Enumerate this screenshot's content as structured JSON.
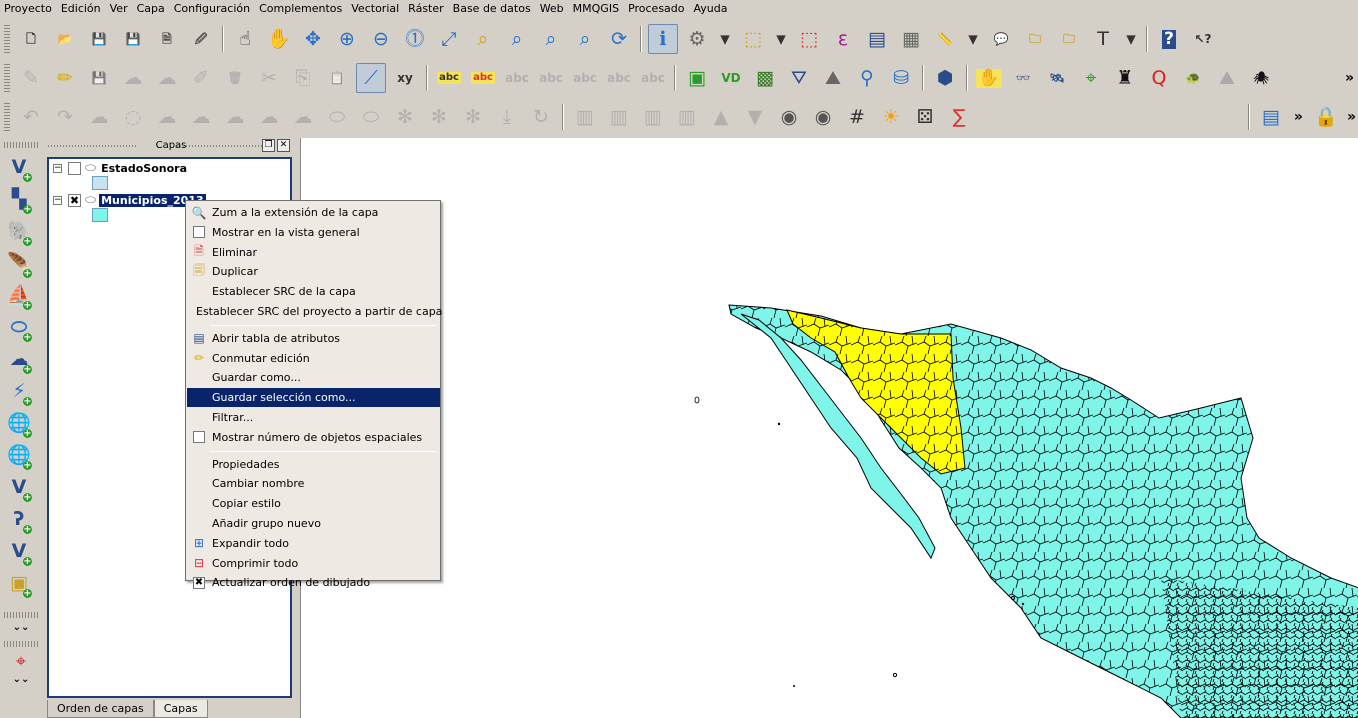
{
  "menubar": [
    "Proyecto",
    "Edición",
    "Ver",
    "Capa",
    "Configuración",
    "Complementos",
    "Vectorial",
    "Ráster",
    "Base de datos",
    "Web",
    "MMQGIS",
    "Procesado",
    "Ayuda"
  ],
  "toolbar1": [
    {
      "name": "new-project-icon",
      "g": "🗋",
      "c": "#333"
    },
    {
      "name": "open-project-icon",
      "g": "📂",
      "c": "#c9a227"
    },
    {
      "name": "save-project-icon",
      "g": "💾",
      "c": "#3c5a8c"
    },
    {
      "name": "save-as-icon",
      "g": "💾",
      "c": "#3c5a8c"
    },
    {
      "name": "new-print-composer-icon",
      "g": "🗎",
      "c": "#555"
    },
    {
      "name": "composer-manager-icon",
      "g": "🖉",
      "c": "#555"
    },
    {
      "sep": true
    },
    {
      "name": "touch-zoom-icon",
      "g": "☝",
      "c": "#333"
    },
    {
      "name": "pan-icon",
      "g": "✋",
      "c": "#333"
    },
    {
      "name": "pan-to-selection-icon",
      "g": "✥",
      "c": "#2a6fc9"
    },
    {
      "name": "zoom-in-icon",
      "g": "⊕",
      "c": "#2a6fc9"
    },
    {
      "name": "zoom-out-icon",
      "g": "⊖",
      "c": "#2a6fc9"
    },
    {
      "name": "zoom-native-icon",
      "g": "⓵",
      "c": "#2a6fc9"
    },
    {
      "name": "zoom-full-icon",
      "g": "⤢",
      "c": "#2a6fc9"
    },
    {
      "name": "zoom-to-selection-icon",
      "g": "⌕",
      "c": "#c9a227"
    },
    {
      "name": "zoom-to-layer-icon",
      "g": "⌕",
      "c": "#2a6fc9"
    },
    {
      "name": "zoom-last-icon",
      "g": "⌕",
      "c": "#2a6fc9"
    },
    {
      "name": "zoom-next-icon",
      "g": "⌕",
      "c": "#2a6fc9"
    },
    {
      "name": "refresh-icon",
      "g": "⟳",
      "c": "#2a6fc9"
    },
    {
      "sep": true
    },
    {
      "name": "identify-icon",
      "g": "ℹ",
      "c": "#2a6fc9",
      "pressed": true
    },
    {
      "name": "run-action-icon",
      "g": "⚙",
      "c": "#666"
    },
    {
      "name": "action-dropdown-icon",
      "g": "▾",
      "c": "#333",
      "sm": true
    },
    {
      "name": "select-features-icon",
      "g": "⬚",
      "c": "#c9a227"
    },
    {
      "name": "select-dropdown-icon",
      "g": "▾",
      "c": "#333",
      "sm": true
    },
    {
      "name": "deselect-icon",
      "g": "⬚",
      "c": "#d33"
    },
    {
      "name": "select-by-expression-icon",
      "g": "ε",
      "c": "#a0208c"
    },
    {
      "name": "attribute-table-icon",
      "g": "▤",
      "c": "#2a4c8c"
    },
    {
      "name": "field-calculator-icon",
      "g": "▦",
      "c": "#666"
    },
    {
      "name": "measure-icon",
      "g": "📏",
      "c": "#333"
    },
    {
      "name": "measure-dropdown-icon",
      "g": "▾",
      "c": "#333",
      "sm": true
    },
    {
      "name": "map-tips-icon",
      "g": "💬",
      "c": "#c9a227"
    },
    {
      "name": "new-bookmark-icon",
      "g": "🗀",
      "c": "#c9a227"
    },
    {
      "name": "show-bookmarks-icon",
      "g": "🗀",
      "c": "#c9a227"
    },
    {
      "name": "text-annotation-icon",
      "g": "T",
      "c": "#333"
    },
    {
      "name": "annotation-dropdown-icon",
      "g": "▾",
      "c": "#333",
      "sm": true
    },
    {
      "sep": true
    },
    {
      "name": "help-contents-icon",
      "g": "?",
      "c": "#fff",
      "bg": "#2a4c8c"
    },
    {
      "name": "whats-this-icon",
      "g": "↖?",
      "c": "#333"
    }
  ],
  "toolbar2": [
    {
      "name": "current-edits-icon",
      "g": "✎",
      "c": "#999",
      "dis": true
    },
    {
      "name": "toggle-editing-icon",
      "g": "✏",
      "c": "#d8a800"
    },
    {
      "name": "save-edits-icon",
      "g": "💾",
      "c": "#999",
      "dis": true
    },
    {
      "name": "add-feature-icon",
      "g": "☁",
      "c": "#999",
      "dis": true
    },
    {
      "name": "move-feature-icon",
      "g": "☁",
      "c": "#999",
      "dis": true
    },
    {
      "name": "node-tool-icon",
      "g": "✐",
      "c": "#999",
      "dis": true
    },
    {
      "name": "delete-selected-icon",
      "g": "🗑",
      "c": "#999",
      "dis": true
    },
    {
      "name": "cut-features-icon",
      "g": "✂",
      "c": "#999",
      "dis": true
    },
    {
      "name": "copy-features-icon",
      "g": "⎘",
      "c": "#999",
      "dis": true
    },
    {
      "name": "paste-features-icon",
      "g": "📋",
      "c": "#999",
      "dis": true
    },
    {
      "name": "measure-line-icon",
      "g": "⟋",
      "c": "#2a6fc9",
      "pressed": true
    },
    {
      "name": "xy-tool-icon",
      "g": "xy",
      "c": "#333"
    },
    {
      "sep": true
    },
    {
      "name": "label-icon",
      "g": "abc",
      "c": "#333",
      "bg": "#f5e35a"
    },
    {
      "name": "layer-labeling-icon",
      "g": "abc",
      "c": "#d33",
      "bg": "#f5e35a"
    },
    {
      "name": "pin-labels-icon",
      "g": "abc",
      "c": "#999",
      "dis": true
    },
    {
      "name": "show-hide-labels-icon",
      "g": "abc",
      "c": "#999",
      "dis": true
    },
    {
      "name": "move-label-icon",
      "g": "abc",
      "c": "#999",
      "dis": true
    },
    {
      "name": "rotate-label-icon",
      "g": "abc",
      "c": "#999",
      "dis": true
    },
    {
      "name": "change-label-icon",
      "g": "abc",
      "c": "#999",
      "dis": true
    },
    {
      "sep": true
    },
    {
      "name": "grass-tools-icon",
      "g": "▣",
      "c": "#2a9c2a"
    },
    {
      "name": "vd-plugin-icon",
      "g": "VD",
      "c": "#2a9c2a"
    },
    {
      "name": "raster-calc-icon",
      "g": "▩",
      "c": "#3a7a2a"
    },
    {
      "name": "interpolation-icon",
      "g": "⛛",
      "c": "#2a4c8c"
    },
    {
      "name": "terrain-icon",
      "g": "⛰",
      "c": "#666"
    },
    {
      "name": "georeferencer-icon",
      "g": "⚲",
      "c": "#2a6fc9"
    },
    {
      "name": "db-manager-icon",
      "g": "⛁",
      "c": "#2a6fc9"
    },
    {
      "sep": true
    },
    {
      "name": "osm-icon",
      "g": "⬢",
      "c": "#2a4c8c"
    },
    {
      "sep": true
    },
    {
      "name": "digitize-icon",
      "g": "✋",
      "c": "#2a6c2a",
      "bg": "#f5e35a"
    },
    {
      "name": "binoculars-icon",
      "g": "👓",
      "c": "#333"
    },
    {
      "name": "satellite-icon",
      "g": "🛰",
      "c": "#2a4c8c"
    },
    {
      "name": "layer-finder-icon",
      "g": "⌖",
      "c": "#2a9c2a"
    },
    {
      "name": "gps-icon",
      "g": "♜",
      "c": "#111"
    },
    {
      "name": "qgis-cloud-icon",
      "g": "Q",
      "c": "#e21c1c"
    },
    {
      "name": "turtle-icon",
      "g": "🐢",
      "c": "#b83030"
    },
    {
      "name": "mountain-icon",
      "g": "⛰",
      "c": "#aaa"
    },
    {
      "name": "spider-icon",
      "g": "🕷",
      "c": "#111"
    }
  ],
  "toolbar3": [
    {
      "name": "undo-icon",
      "g": "↶",
      "c": "#999",
      "dis": true
    },
    {
      "name": "redo-icon",
      "g": "↷",
      "c": "#999",
      "dis": true
    },
    {
      "name": "simplify-icon",
      "g": "☁",
      "c": "#999",
      "dis": true
    },
    {
      "name": "add-ring-icon",
      "g": "◌",
      "c": "#999",
      "dis": true
    },
    {
      "name": "add-part-icon",
      "g": "☁",
      "c": "#999",
      "dis": true
    },
    {
      "name": "fill-ring-icon",
      "g": "☁",
      "c": "#999",
      "dis": true
    },
    {
      "name": "delete-ring-icon",
      "g": "☁",
      "c": "#999",
      "dis": true
    },
    {
      "name": "delete-part-icon",
      "g": "☁",
      "c": "#999",
      "dis": true
    },
    {
      "name": "reshape-icon",
      "g": "☁",
      "c": "#999",
      "dis": true
    },
    {
      "name": "offset-curve-icon",
      "g": "⬭",
      "c": "#999",
      "dis": true
    },
    {
      "name": "split-features-icon",
      "g": "⬭",
      "c": "#999",
      "dis": true
    },
    {
      "name": "split-parts-icon",
      "g": "✻",
      "c": "#999",
      "dis": true
    },
    {
      "name": "merge-features-icon",
      "g": "✻",
      "c": "#999",
      "dis": true
    },
    {
      "name": "merge-attributes-icon",
      "g": "✻",
      "c": "#999",
      "dis": true
    },
    {
      "name": "rotate-symbols-icon",
      "g": "⤓",
      "c": "#999",
      "dis": true
    },
    {
      "name": "rotate-feature-icon",
      "g": "↻",
      "c": "#999",
      "dis": true
    },
    {
      "sep": true
    },
    {
      "name": "align-left-icon",
      "g": "▥",
      "c": "#999",
      "dis": true
    },
    {
      "name": "align-center-icon",
      "g": "▥",
      "c": "#999",
      "dis": true
    },
    {
      "name": "align-right-icon",
      "g": "▥",
      "c": "#999",
      "dis": true
    },
    {
      "name": "distribute-icon",
      "g": "▥",
      "c": "#999",
      "dis": true
    },
    {
      "name": "raise-icon",
      "g": "▲",
      "c": "#999",
      "dis": true
    },
    {
      "name": "lower-icon",
      "g": "▼",
      "c": "#999",
      "dis": true
    },
    {
      "name": "heatmap-icon",
      "g": "◉",
      "c": "#555"
    },
    {
      "name": "coordinate-capture-icon",
      "g": "◉",
      "c": "#555"
    },
    {
      "name": "grid-icon",
      "g": "#",
      "c": "#333"
    },
    {
      "name": "sun-icon",
      "g": "☀",
      "c": "#f0a010"
    },
    {
      "name": "dice-icon",
      "g": "⚄",
      "c": "#333"
    },
    {
      "name": "statistics-icon",
      "g": "∑",
      "c": "#d33"
    }
  ],
  "toolbar3_right": [
    {
      "name": "plugin-manager-icon",
      "g": "▤",
      "c": "#2a6fc9"
    },
    {
      "name": "lock-icon",
      "g": "🔒",
      "c": "#111"
    }
  ],
  "leftbar": [
    {
      "name": "add-vector-layer-icon",
      "g": "V",
      "c": "#2a4c8c"
    },
    {
      "name": "add-raster-layer-icon",
      "g": "▚",
      "c": "#2a4c8c"
    },
    {
      "name": "add-postgis-layer-icon",
      "g": "🐘",
      "c": "#2a6fc9"
    },
    {
      "name": "add-spatialite-layer-icon",
      "g": "🪶",
      "c": "#2a6fc9"
    },
    {
      "name": "add-mssql-layer-icon",
      "g": "⛵",
      "c": "#2a6fc9"
    },
    {
      "name": "add-oracle-layer-icon",
      "g": "⬭",
      "c": "#2a6fc9"
    },
    {
      "name": "add-db2-layer-icon",
      "g": "☁",
      "c": "#2a4c8c"
    },
    {
      "name": "add-wms-layer-icon",
      "g": "⚡",
      "c": "#2a6fc9"
    },
    {
      "name": "add-wcs-layer-icon",
      "g": "🌐",
      "c": "#2a6fc9"
    },
    {
      "name": "add-wfs-layer-icon",
      "g": "🌐",
      "c": "#2a4c8c"
    },
    {
      "name": "add-delimited-text-icon",
      "g": "V",
      "c": "#2a4c8c"
    },
    {
      "name": "add-virtual-layer-icon",
      "g": "ʔ",
      "c": "#2a4c8c"
    },
    {
      "name": "new-shapefile-icon",
      "g": "V",
      "c": "#2a4c8c"
    },
    {
      "name": "new-gpx-layer-icon",
      "g": "▣",
      "c": "#c9a227"
    }
  ],
  "leftbar_bottom": {
    "expand": "⌄⌄",
    "collapse": "⌄⌄"
  },
  "panel": {
    "title": "Capas",
    "float_btn": "❐",
    "close_btn": "✕",
    "layers": [
      {
        "name": "EstadoSonora",
        "checked": "",
        "expander": "−",
        "swatch": "#c8e3f0"
      },
      {
        "name": "Municipios_2013",
        "checked": "✖",
        "expander": "−",
        "swatch": "#7ff5ea"
      }
    ],
    "tabs": [
      "Orden de capas",
      "Capas"
    ]
  },
  "context_menu": {
    "items": [
      {
        "label": "Zum a la extensión de la capa",
        "icon": "zoom-layer-icon",
        "g": "🔍"
      },
      {
        "label": "Mostrar en la vista general",
        "icon": "checkbox",
        "chk": true
      },
      {
        "label": "Eliminar",
        "icon": "remove-icon",
        "g": "🗎"
      },
      {
        "label": "Duplicar",
        "icon": "duplicate-icon",
        "g": "🗐"
      },
      {
        "label": "Establecer SRC de la capa",
        "icon": ""
      },
      {
        "label": "Establecer SRC del proyecto a partir de capa",
        "icon": ""
      },
      {
        "sep": true
      },
      {
        "label": "Abrir tabla de atributos",
        "icon": "attribute-table-icon",
        "g": "▤"
      },
      {
        "label": "Conmutar edición",
        "icon": "toggle-editing-icon",
        "g": "✏"
      },
      {
        "label": "Guardar como...",
        "icon": ""
      },
      {
        "label": "Guardar selección como...",
        "icon": "",
        "hl": true
      },
      {
        "label": "Filtrar...",
        "icon": ""
      },
      {
        "label": "Mostrar número de objetos espaciales",
        "icon": "checkbox",
        "chk": true
      },
      {
        "sep": true
      },
      {
        "label": "Propiedades",
        "icon": ""
      },
      {
        "label": "Cambiar nombre",
        "icon": ""
      },
      {
        "label": "Copiar estilo",
        "icon": ""
      },
      {
        "label": "Añadir grupo nuevo",
        "icon": ""
      },
      {
        "label": "Expandir todo",
        "icon": "expand-all-icon",
        "g": "⊞"
      },
      {
        "label": "Comprimir todo",
        "icon": "collapse-all-icon",
        "g": "⊟"
      },
      {
        "label": "Actualizar orden de dibujado",
        "icon": "checkbox-checked",
        "chk": true,
        "checked": "✖"
      }
    ]
  },
  "colors": {
    "municipios": "#7ff5ea",
    "sonora": "#ffff00",
    "highlight": "#0a246a"
  }
}
